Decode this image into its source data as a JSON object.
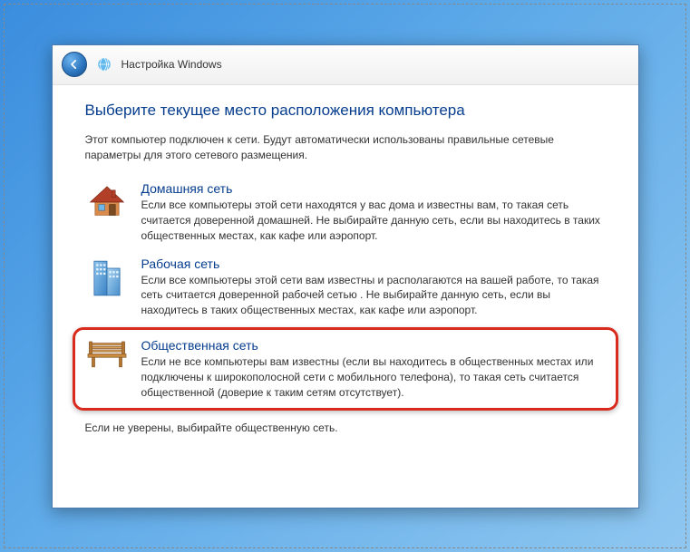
{
  "header": {
    "title": "Настройка Windows"
  },
  "page": {
    "heading": "Выберите текущее место расположения компьютера",
    "intro": "Этот компьютер подключен к сети. Будут автоматически использованы правильные сетевые параметры для этого сетевого размещения.",
    "hint": "Если не уверены, выбирайте общественную сеть."
  },
  "options": [
    {
      "icon": "house-icon",
      "title": "Домашняя сеть",
      "desc": "Если все компьютеры этой сети находятся у вас дома и известны вам, то такая сеть считается доверенной домашней. Не выбирайте данную сеть, если вы находитесь в таких общественных местах, как кафе или аэропорт."
    },
    {
      "icon": "office-icon",
      "title": "Рабочая сеть",
      "desc": "Если все компьютеры этой сети вам известны и располагаются на вашей работе, то такая сеть считается доверенной рабочей сетью . Не выбирайте данную сеть, если вы находитесь в таких общественных местах, как кафе или аэропорт."
    },
    {
      "icon": "bench-icon",
      "title": "Общественная сеть",
      "desc": "Если не все компьютеры вам известны (если вы находитесь в общественных местах или подключены к широкополосной сети с мобильного телефона), то такая сеть считается общественной (доверие к таким сетям отсутствует)."
    }
  ],
  "colors": {
    "accent": "#063d8e",
    "highlight": "#d92a1e"
  }
}
